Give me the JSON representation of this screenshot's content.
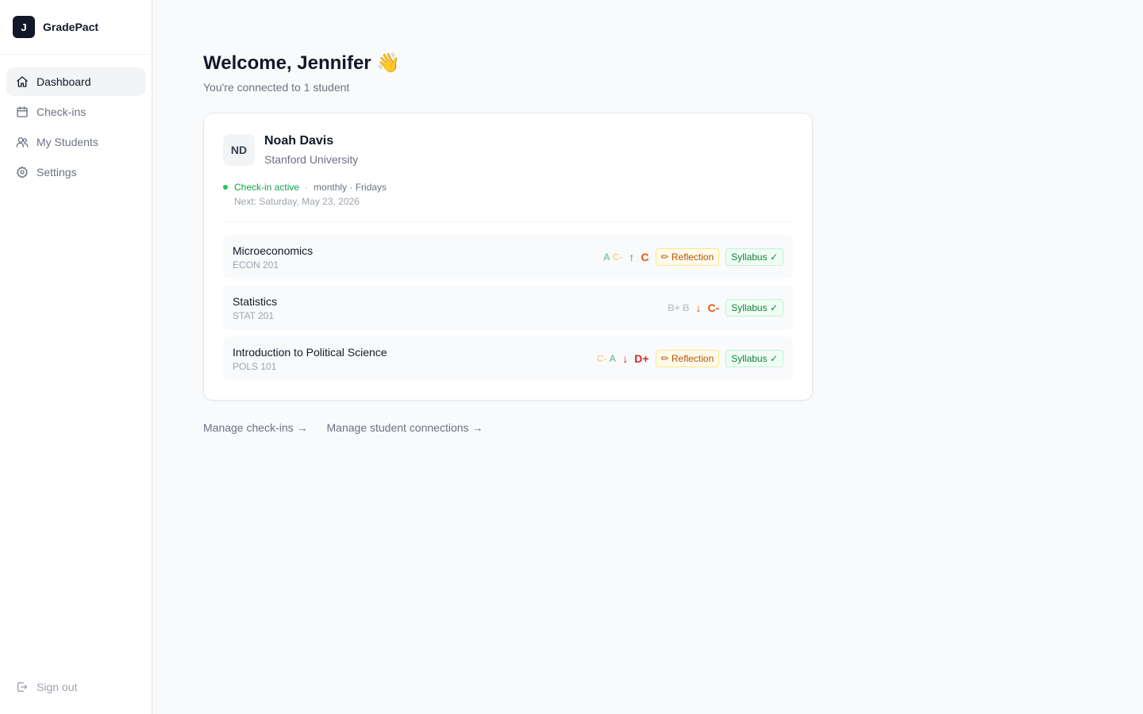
{
  "app": {
    "logo_letter": "J",
    "name": "GradePact"
  },
  "sidebar": {
    "items": [
      {
        "label": "Dashboard",
        "icon": "home-icon",
        "active": true
      },
      {
        "label": "Check-ins",
        "icon": "calendar-icon"
      },
      {
        "label": "My Students",
        "icon": "users-icon"
      },
      {
        "label": "Settings",
        "icon": "gear-icon"
      }
    ],
    "sign_out": "Sign out"
  },
  "header": {
    "title": "Welcome, Jennifer 👋",
    "subtitle": "You're connected to 1 student"
  },
  "student": {
    "initials": "ND",
    "name": "Noah Davis",
    "school": "Stanford University",
    "status": "Check-in active",
    "separator": "·",
    "frequency": "monthly · Fridays",
    "next": "Next: Saturday, May 23, 2026",
    "courses": [
      {
        "name": "Microeconomics",
        "code": "ECON 201",
        "prev_grades": [
          "A",
          "C-"
        ],
        "trend": "↑",
        "grade": "C",
        "reflection": "✏ Reflection",
        "syllabus": "Syllabus ✓"
      },
      {
        "name": "Statistics",
        "code": "STAT 201",
        "prev_grades": [
          "B+",
          "B"
        ],
        "trend": "↓",
        "grade": "C-",
        "syllabus": "Syllabus ✓"
      },
      {
        "name": "Introduction to Political Science",
        "code": "POLS 101",
        "prev_grades": [
          "C-",
          "A"
        ],
        "trend": "↓",
        "grade": "D+",
        "reflection": "✏ Reflection",
        "syllabus": "Syllabus ✓"
      }
    ]
  },
  "links": {
    "manage_checkins": "Manage check-ins →",
    "manage_connections": "Manage student connections →"
  },
  "colors": {
    "grade_green": "#86c5a0",
    "grade_orange_light": "#fcd09a",
    "grade_gray": "#c4c8ce",
    "trend_up": "#16a34a",
    "trend_down_orange": "#ea580c",
    "trend_down_red": "#dc2626",
    "grade_c": "#ea580c",
    "grade_d": "#dc2626"
  }
}
